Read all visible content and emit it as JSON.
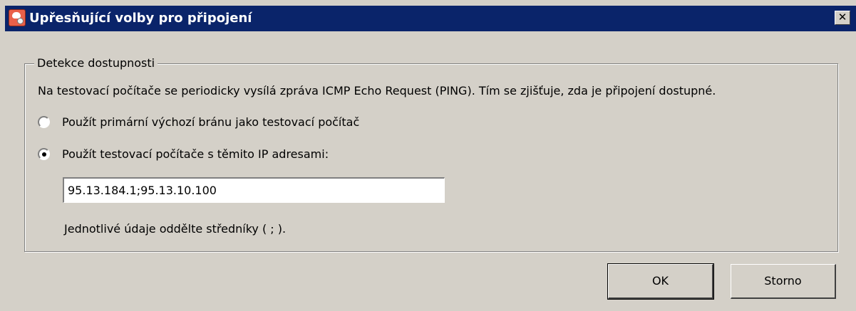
{
  "window": {
    "title": "Upřesňující volby pro připojení",
    "close_glyph": "✕"
  },
  "group": {
    "legend": "Detekce dostupnosti",
    "description": "Na testovací počítače se periodicky vysílá zpráva ICMP Echo Request (PING). Tím se zjišťuje, zda je připojení dostupné.",
    "options": [
      {
        "label": "Použít primární výchozí bránu jako testovací počítač",
        "checked": false
      },
      {
        "label": "Použít testovací počítače s těmito IP adresami:",
        "checked": true
      }
    ],
    "ip_field_value": "95.13.184.1;95.13.10.100",
    "hint": "Jednotlivé údaje oddělte středníky ( ; )."
  },
  "buttons": {
    "ok_label": "OK",
    "cancel_label": "Storno"
  },
  "icons": {
    "app": "connection-settings-icon",
    "close": "close-icon"
  }
}
